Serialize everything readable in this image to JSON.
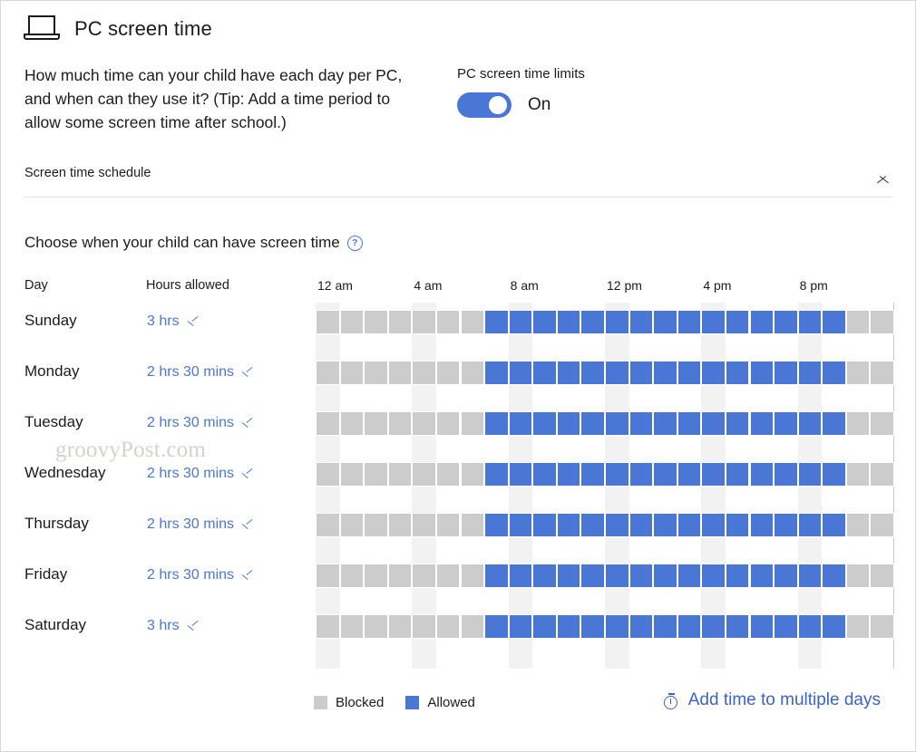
{
  "header": {
    "icon": "laptop-icon",
    "title": "PC screen time"
  },
  "description": "How much time can your child have each day per PC, and when can they use it? (Tip: Add a time period to allow some screen time after school.)",
  "limits": {
    "label": "PC screen time limits",
    "state": "On",
    "toggle_on": true,
    "accent": "#4a76d6"
  },
  "accordion": {
    "title": "Screen time schedule",
    "chevron": "chevron-up-icon",
    "expanded": true
  },
  "choose": {
    "text": "Choose when your child can have screen time",
    "help_icon": "help-icon",
    "help_glyph": "?"
  },
  "table": {
    "col_day": "Day",
    "col_hours": "Hours allowed",
    "time_ticks": [
      {
        "label": "12 am",
        "hour": 0
      },
      {
        "label": "4 am",
        "hour": 4
      },
      {
        "label": "8 am",
        "hour": 8
      },
      {
        "label": "12 pm",
        "hour": 12
      },
      {
        "label": "4 pm",
        "hour": 16
      },
      {
        "label": "8 pm",
        "hour": 20
      }
    ],
    "rows": [
      {
        "day": "Sunday",
        "hours": "3 hrs",
        "allowed_start": 7,
        "allowed_end": 22
      },
      {
        "day": "Monday",
        "hours": "2 hrs 30 mins",
        "allowed_start": 7,
        "allowed_end": 22
      },
      {
        "day": "Tuesday",
        "hours": "2 hrs 30 mins",
        "allowed_start": 7,
        "allowed_end": 22
      },
      {
        "day": "Wednesday",
        "hours": "2 hrs 30 mins",
        "allowed_start": 7,
        "allowed_end": 22
      },
      {
        "day": "Thursday",
        "hours": "2 hrs 30 mins",
        "allowed_start": 7,
        "allowed_end": 22
      },
      {
        "day": "Friday",
        "hours": "2 hrs 30 mins",
        "allowed_start": 7,
        "allowed_end": 22
      },
      {
        "day": "Saturday",
        "hours": "3 hrs",
        "allowed_start": 7,
        "allowed_end": 22
      }
    ]
  },
  "legend": [
    {
      "label": "Blocked",
      "color": "#cccccc",
      "kind": "blocked"
    },
    {
      "label": "Allowed",
      "color": "#4a76d6",
      "kind": "allowed"
    }
  ],
  "add_time": {
    "label": "Add time to multiple days",
    "icon": "timer-icon"
  },
  "watermark": "groovyPost.com",
  "chart_data": {
    "type": "heatmap",
    "title": "Choose when your child can have screen time",
    "xlabel": "",
    "ylabel": "",
    "x": [
      "12 am",
      "1 am",
      "2 am",
      "3 am",
      "4 am",
      "5 am",
      "6 am",
      "7 am",
      "8 am",
      "9 am",
      "10 am",
      "11 am",
      "12 pm",
      "1 pm",
      "2 pm",
      "3 pm",
      "4 pm",
      "5 pm",
      "6 pm",
      "7 pm",
      "8 pm",
      "9 pm",
      "10 pm",
      "11 pm"
    ],
    "categories": [
      "Sunday",
      "Monday",
      "Tuesday",
      "Wednesday",
      "Thursday",
      "Friday",
      "Saturday"
    ],
    "legend": [
      "Blocked",
      "Allowed"
    ],
    "legend_position": "bottom-left",
    "values": [
      [
        0,
        0,
        0,
        0,
        0,
        0,
        0,
        1,
        1,
        1,
        1,
        1,
        1,
        1,
        1,
        1,
        1,
        1,
        1,
        1,
        1,
        1,
        0,
        0
      ],
      [
        0,
        0,
        0,
        0,
        0,
        0,
        0,
        1,
        1,
        1,
        1,
        1,
        1,
        1,
        1,
        1,
        1,
        1,
        1,
        1,
        1,
        1,
        0,
        0
      ],
      [
        0,
        0,
        0,
        0,
        0,
        0,
        0,
        1,
        1,
        1,
        1,
        1,
        1,
        1,
        1,
        1,
        1,
        1,
        1,
        1,
        1,
        1,
        0,
        0
      ],
      [
        0,
        0,
        0,
        0,
        0,
        0,
        0,
        1,
        1,
        1,
        1,
        1,
        1,
        1,
        1,
        1,
        1,
        1,
        1,
        1,
        1,
        1,
        0,
        0
      ],
      [
        0,
        0,
        0,
        0,
        0,
        0,
        0,
        1,
        1,
        1,
        1,
        1,
        1,
        1,
        1,
        1,
        1,
        1,
        1,
        1,
        1,
        1,
        0,
        0
      ],
      [
        0,
        0,
        0,
        0,
        0,
        0,
        0,
        1,
        1,
        1,
        1,
        1,
        1,
        1,
        1,
        1,
        1,
        1,
        1,
        1,
        1,
        1,
        0,
        0
      ],
      [
        0,
        0,
        0,
        0,
        0,
        0,
        0,
        1,
        1,
        1,
        1,
        1,
        1,
        1,
        1,
        1,
        1,
        1,
        1,
        1,
        1,
        1,
        0,
        0
      ]
    ]
  }
}
